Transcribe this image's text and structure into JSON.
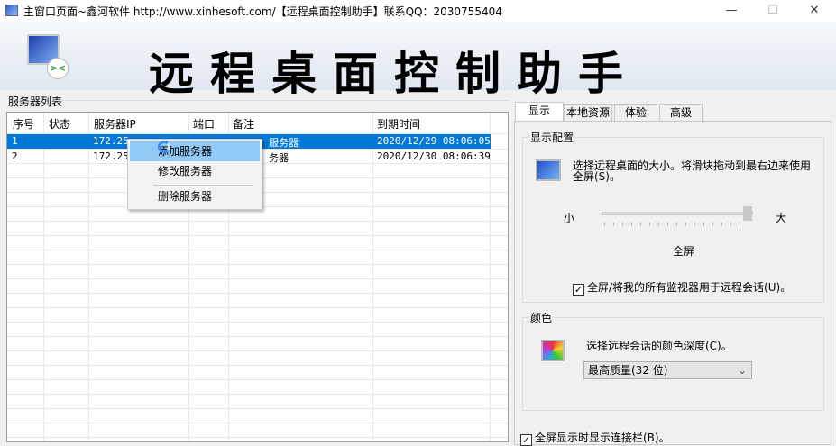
{
  "window": {
    "title": "主窗口页面~鑫河软件 http://www.xinhesoft.com/【远程桌面控制助手】联系QQ：2030755404",
    "minimize": "—",
    "maximize": "☐",
    "close": "✕"
  },
  "banner": {
    "text": "远程桌面控制助手"
  },
  "server_list": {
    "label": "服务器列表",
    "columns": [
      "序号",
      "状态",
      "服务器IP",
      "端口",
      "备注",
      "到期时间"
    ],
    "rows": [
      {
        "no": "1",
        "status": "",
        "ip": "172.25",
        "port": "",
        "note": "服务器",
        "expire": "2020/12/29 08:06:05"
      },
      {
        "no": "2",
        "status": "",
        "ip": "172.25",
        "port": "",
        "note": "务器",
        "expire": "2020/12/30 08:06:39"
      }
    ]
  },
  "context_menu": {
    "items": [
      "添加服务器",
      "修改服务器",
      "删除服务器"
    ]
  },
  "tabs": [
    "显示",
    "本地资源",
    "体验",
    "高级"
  ],
  "display": {
    "group_label": "显示配置",
    "description": "选择远程桌面的大小。将滑块拖动到最右边来使用全屏(S)。",
    "small": "小",
    "large": "大",
    "slider_value": 1.0,
    "size_value": "全屏",
    "multi_monitor_label": "全屏/将我的所有监视器用于远程会话(U)。",
    "multi_monitor_checked": true
  },
  "color": {
    "group_label": "颜色",
    "description": "选择远程会话的颜色深度(C)。",
    "selected": "最高质量(32 位)"
  },
  "connection_bar": {
    "label": "全屏显示时显示连接栏(B)。",
    "checked": true
  },
  "colors": {
    "selection": "#0078d7",
    "menu_highlight": "#91c9f7"
  }
}
